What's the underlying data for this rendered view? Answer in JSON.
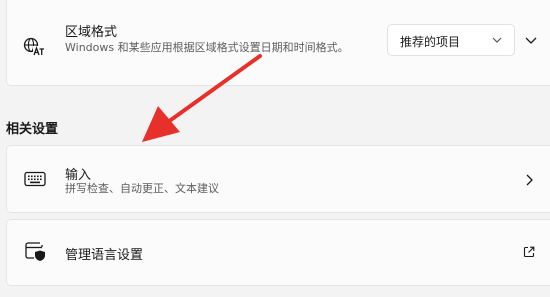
{
  "region": {
    "title": "区域格式",
    "description": "Windows 和某些应用根据区域格式设置日期和时间格式。",
    "dropdown_value": "推荐的项目",
    "icon": "language-region-icon"
  },
  "related": {
    "heading": "相关设置",
    "input": {
      "title": "输入",
      "description": "拼写检查、自动更正、文本建议",
      "icon": "keyboard-icon"
    },
    "language_admin": {
      "title": "管理语言设置",
      "icon": "language-admin-icon"
    }
  },
  "colors": {
    "annotation_arrow": "#e8302a"
  }
}
